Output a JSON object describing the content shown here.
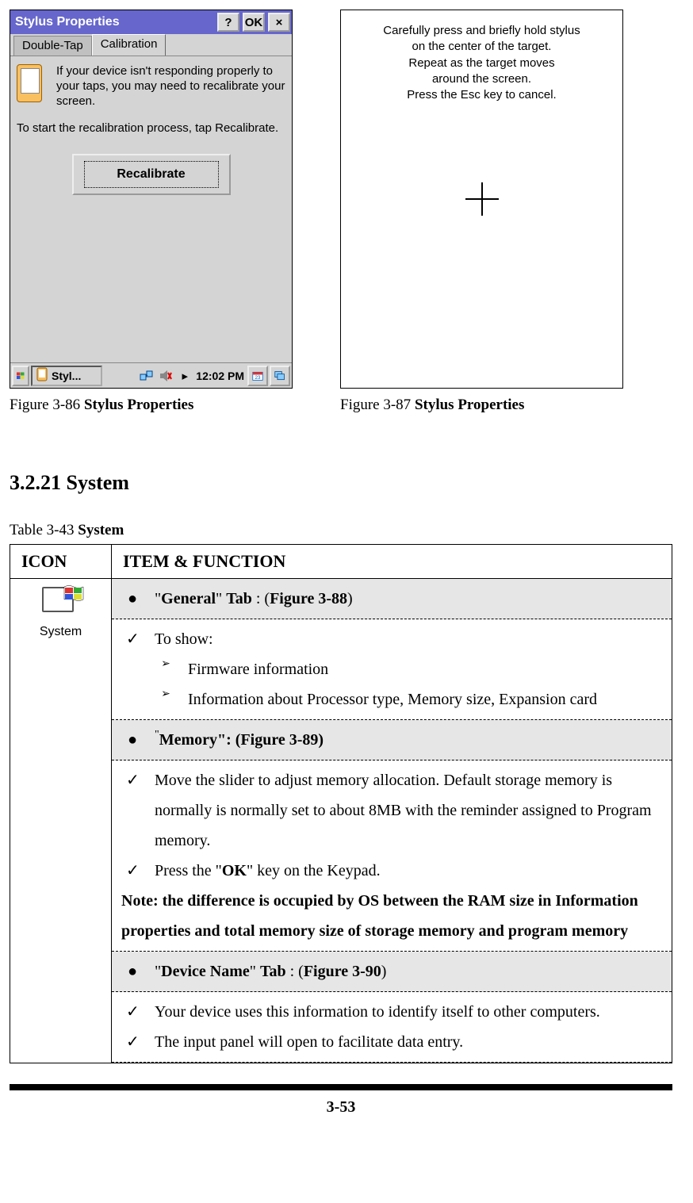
{
  "figures": {
    "left": {
      "titlebar": "Stylus Properties",
      "btn_help": "?",
      "btn_ok": "OK",
      "btn_close": "×",
      "tab_doubletap": "Double-Tap",
      "tab_calibration": "Calibration",
      "info_text": "If your device isn't responding properly to your taps, you may need to recalibrate your screen.",
      "start_text": "To start the recalibration process, tap Recalibrate.",
      "recalibrate_btn": "Recalibrate",
      "task_app": "Styl...",
      "task_time": "12:02 PM",
      "caption_prefix": "Figure 3-86 ",
      "caption_bold": "Stylus Properties"
    },
    "right": {
      "line1": "Carefully press and briefly hold stylus",
      "line2": "on the center of the target.",
      "line3": "Repeat as the target moves",
      "line4": "around the screen.",
      "line5": "Press the Esc key to cancel.",
      "caption_prefix": "Figure 3-87 ",
      "caption_bold": "Stylus Properties"
    }
  },
  "section": {
    "heading": "3.2.21 System",
    "table_caption_prefix": "Table 3-43 ",
    "table_caption_bold": "System"
  },
  "table": {
    "head_icon": "ICON",
    "head_item": "ITEM & FUNCTION",
    "icon_label": "System",
    "rows": {
      "general_tab": {
        "q1": "\"",
        "b1": "General",
        "q2": "\" ",
        "b2": "Tab",
        "mid": " : (",
        "ref": "Figure 3-88",
        "end": ")"
      },
      "general_body": {
        "to_show": "To show:",
        "fw": "Firmware information",
        "proc": "Information about Processor type, Memory size, Expansion card"
      },
      "memory_tab": {
        "q1": "\"",
        "b1": "Memory\": (",
        "ref": "Figure 3-89",
        "end": ")"
      },
      "memory_body": {
        "slider": "Move the slider to adjust memory allocation. Default storage memory is normally is normally set to about 8MB with the reminder assigned to Program memory.",
        "press_a": "Press the \"",
        "press_ok": "OK",
        "press_b": "\" key on the Keypad.",
        "note": "Note: the difference is occupied by OS between the RAM size in Information properties and total memory size of storage memory and program memory"
      },
      "devname_tab": {
        "q1": "\"",
        "b1": "Device Name",
        "q2": "\" ",
        "b2": "Tab",
        "mid": " : (",
        "ref": "Figure 3-90",
        "end": ")"
      },
      "devname_body": {
        "ident": "Your device uses this information to identify itself to other computers.",
        "input": "The input panel will open to facilitate data entry."
      }
    }
  },
  "page_number": "3-53"
}
